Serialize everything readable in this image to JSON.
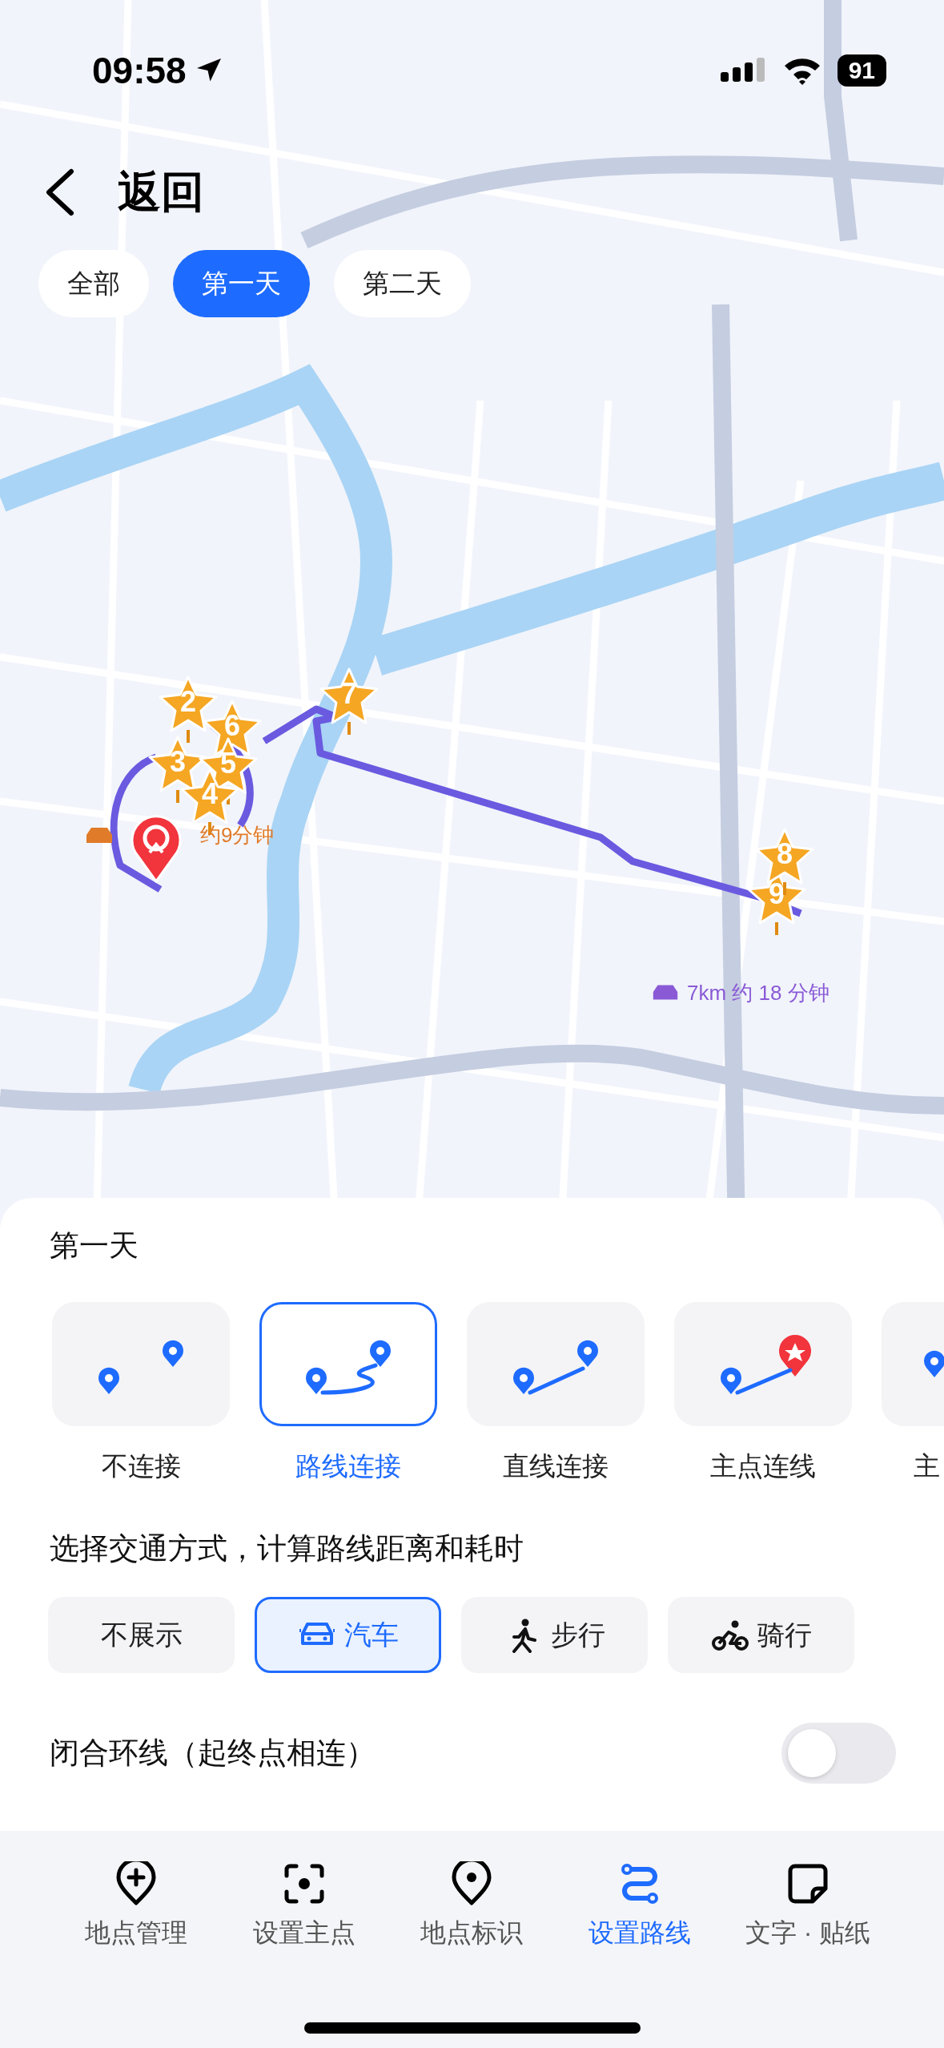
{
  "status_bar": {
    "time": "09:58",
    "battery": "91"
  },
  "header": {
    "back_label": "返回"
  },
  "day_tabs": [
    {
      "label": "全部",
      "selected": false
    },
    {
      "label": "第一天",
      "selected": true
    },
    {
      "label": "第二天",
      "selected": false
    }
  ],
  "map": {
    "markers": [
      {
        "label": "2"
      },
      {
        "label": "6"
      },
      {
        "label": "3"
      },
      {
        "label": "5"
      },
      {
        "label": "4"
      },
      {
        "label": "7"
      },
      {
        "label": "9"
      },
      {
        "label": "8"
      }
    ],
    "route_labels": [
      {
        "text": "约9分钟",
        "color": "#e07b2a"
      },
      {
        "text": "7km 约 18 分钟",
        "color": "#8a5ad6"
      }
    ]
  },
  "sheet": {
    "title": "第一天",
    "connect_options": [
      {
        "kind": "none",
        "label": "不连接",
        "selected": false
      },
      {
        "kind": "route",
        "label": "路线连接",
        "selected": true
      },
      {
        "kind": "straight",
        "label": "直线连接",
        "selected": false
      },
      {
        "kind": "main",
        "label": "主点连线",
        "selected": false
      },
      {
        "kind": "main",
        "label": "主",
        "selected": false
      }
    ],
    "transport_title": "选择交通方式，计算路线距离和耗时",
    "transport_options": [
      {
        "kind": "none",
        "label": "不展示",
        "selected": false
      },
      {
        "kind": "car",
        "label": "汽车",
        "selected": true
      },
      {
        "kind": "walk",
        "label": "步行",
        "selected": false
      },
      {
        "kind": "bike",
        "label": "骑行",
        "selected": false
      }
    ],
    "loop": {
      "label": "闭合环线（起终点相连）",
      "on": false
    }
  },
  "bottom_nav": [
    {
      "kind": "pin-plus",
      "label": "地点管理",
      "selected": false
    },
    {
      "kind": "focus",
      "label": "设置主点",
      "selected": false
    },
    {
      "kind": "pin",
      "label": "地点标识",
      "selected": false
    },
    {
      "kind": "route",
      "label": "设置路线",
      "selected": true
    },
    {
      "kind": "sticker",
      "label": "文字 · 贴纸",
      "selected": false
    }
  ]
}
